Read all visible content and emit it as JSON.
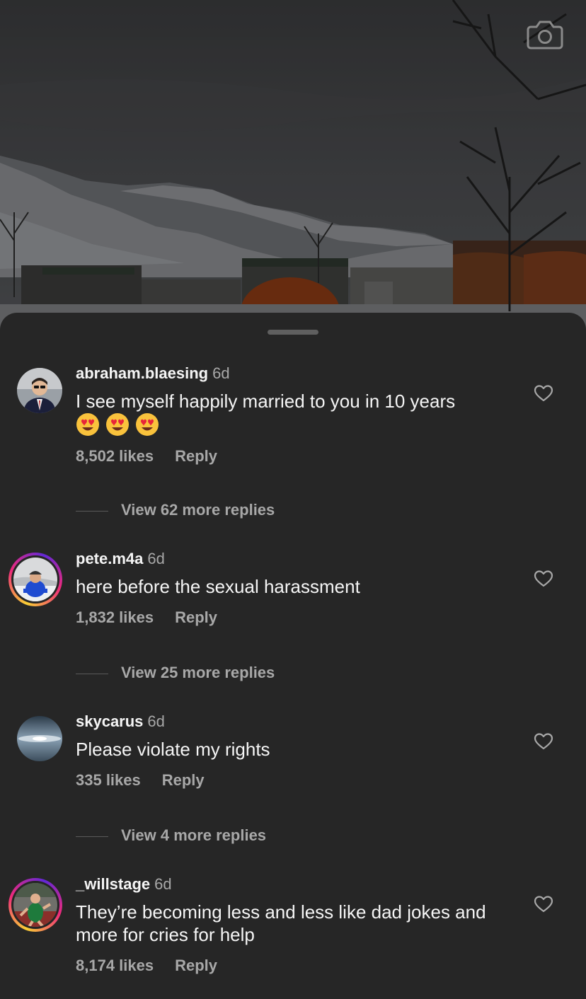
{
  "header": {
    "camera_icon": "camera-icon"
  },
  "comments": [
    {
      "username": "abraham.blaesing",
      "time": "6d",
      "text": "I see myself happily married to you in 10 years",
      "emojis": [
        "heart-eyes",
        "heart-eyes",
        "heart-eyes"
      ],
      "likes": "8,502 likes",
      "reply": "Reply",
      "view_replies": "View 62 more replies",
      "has_story_ring": false
    },
    {
      "username": "pete.m4a",
      "time": "6d",
      "text": "here before the sexual harassment",
      "likes": "1,832 likes",
      "reply": "Reply",
      "view_replies": "View 25 more replies",
      "has_story_ring": true
    },
    {
      "username": "skycarus",
      "time": "6d",
      "text": "Please violate my rights",
      "likes": "335 likes",
      "reply": "Reply",
      "view_replies": "View 4 more replies",
      "has_story_ring": false
    },
    {
      "username": "_willstage",
      "time": "6d",
      "text": "They’re becoming less and less like dad jokes and more for cries for help",
      "likes": "8,174 likes",
      "reply": "Reply",
      "has_story_ring": true
    }
  ],
  "colors": {
    "sheet_background": "#262626",
    "primary_text": "#f5f5f5",
    "secondary_text": "#a8a8a8"
  }
}
